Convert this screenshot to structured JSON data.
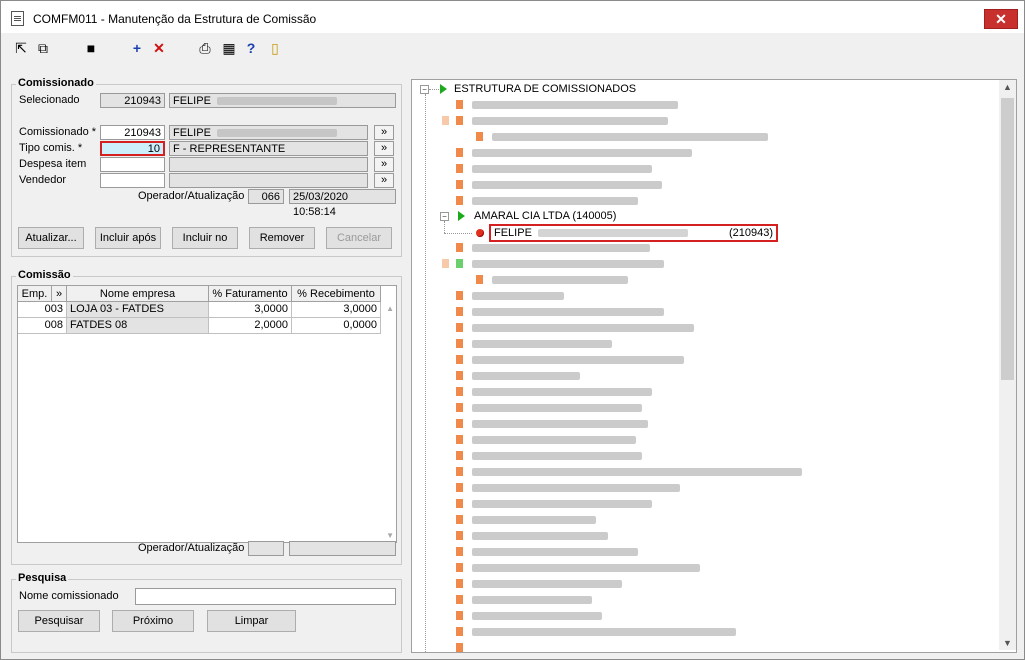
{
  "window": {
    "title": "COMFM011 - Manutenção da Estrutura de Comissão",
    "close": "✕"
  },
  "toolbar": {
    "icons": [
      "first-icon",
      "prev-icon",
      "save-icon",
      "add-icon",
      "delete-icon",
      "print-icon",
      "calc-icon",
      "help-icon",
      "exit-icon"
    ]
  },
  "comissionado": {
    "title": "Comissionado",
    "selecionado_label": "Selecionado",
    "selecionado_code": "210943",
    "selecionado_name": "FELIPE",
    "comissionado_label": "Comissionado *",
    "comissionado_code": "210943",
    "comissionado_name": "FELIPE",
    "tipo_label": "Tipo comis. *",
    "tipo_code": "10",
    "tipo_desc": "F - REPRESENTANTE",
    "despesa_label": "Despesa item",
    "vendedor_label": "Vendedor",
    "lookup": "»",
    "operador_label": "Operador/Atualização",
    "operador_code": "066",
    "operador_datetime": "25/03/2020 10:58:14",
    "buttons": {
      "atualizar": "Atualizar...",
      "incluir_apos": "Incluir após",
      "incluir_no": "Incluir no",
      "remover": "Remover",
      "cancelar": "Cancelar"
    }
  },
  "comissao": {
    "title": "Comissão",
    "columns": [
      "Emp.",
      "»",
      "Nome empresa",
      "% Faturamento",
      "% Recebimento"
    ],
    "rows": [
      {
        "emp": "003",
        "nome": "LOJA 03 - FATDES",
        "fat": "3,0000",
        "rec": "3,0000"
      },
      {
        "emp": "008",
        "nome": "FATDES 08",
        "fat": "2,0000",
        "rec": "0,0000"
      }
    ],
    "operador_label": "Operador/Atualização"
  },
  "pesquisa": {
    "title": "Pesquisa",
    "nome_label": "Nome comissionado",
    "nome_value": "",
    "buttons": {
      "pesquisar": "Pesquisar",
      "proximo": "Próximo",
      "limpar": "Limpar"
    }
  },
  "tree": {
    "root": "ESTRUTURA DE COMISSIONADOS",
    "parent": "AMARAL CIA LTDA (140005)",
    "selected_name": "FELIPE",
    "selected_code": "(210943)",
    "expander_open": "⊟",
    "scroll_up": "▲",
    "scroll_down": "▼"
  }
}
